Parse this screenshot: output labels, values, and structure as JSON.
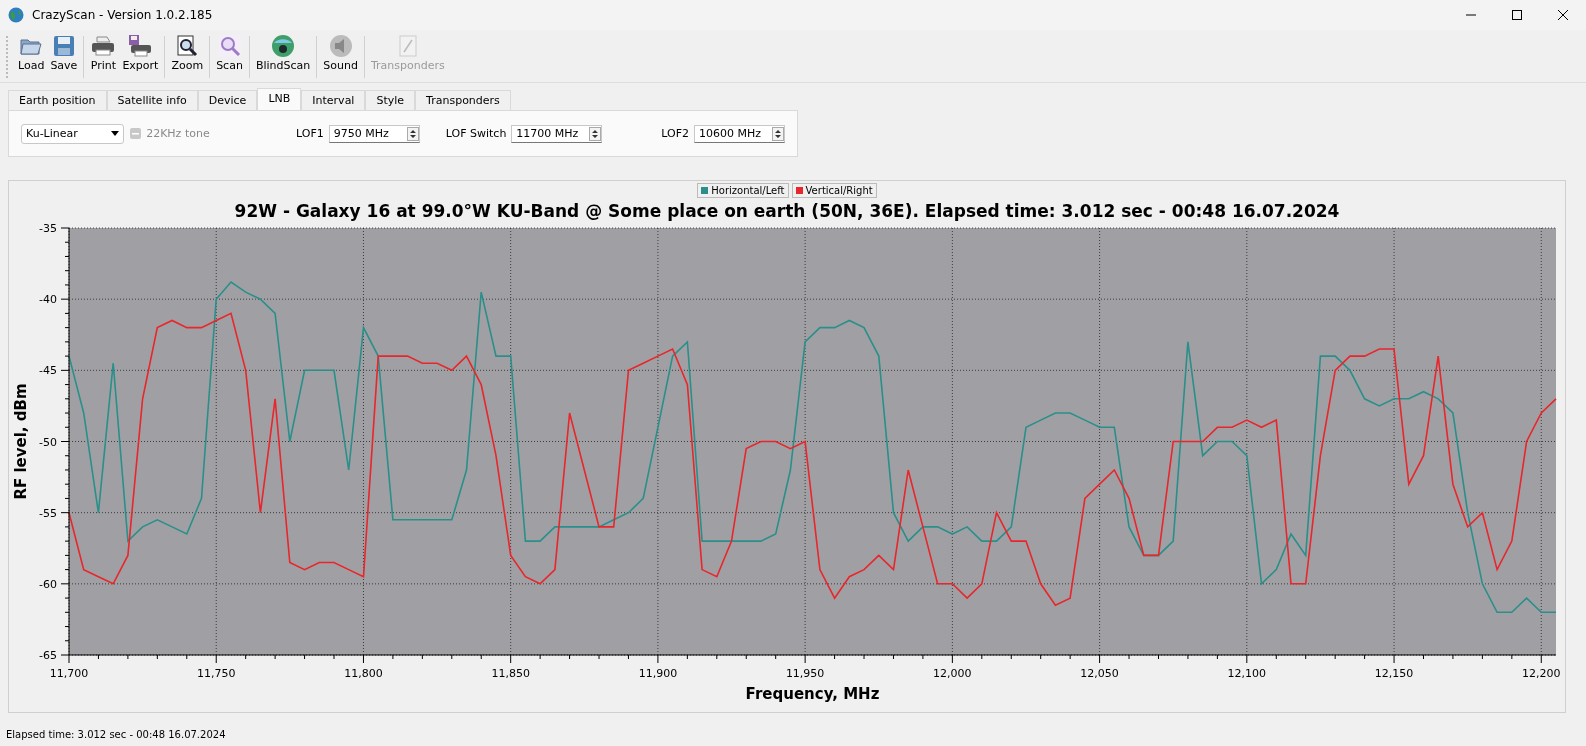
{
  "window": {
    "title": "CrazyScan - Version 1.0.2.185"
  },
  "toolbar": {
    "groups": [
      [
        {
          "label": "Load",
          "disabled": false
        },
        {
          "label": "Save",
          "disabled": false
        }
      ],
      [
        {
          "label": "Print",
          "disabled": false
        },
        {
          "label": "Export",
          "disabled": false
        }
      ],
      [
        {
          "label": "Zoom",
          "disabled": false
        }
      ],
      [
        {
          "label": "Scan",
          "disabled": false
        }
      ],
      [
        {
          "label": "BlindScan",
          "disabled": false
        }
      ],
      [
        {
          "label": "Sound",
          "disabled": false
        }
      ],
      [
        {
          "label": "Transponders",
          "disabled": true
        }
      ]
    ]
  },
  "tabs": [
    {
      "label": "Earth position",
      "selected": false
    },
    {
      "label": "Satellite info",
      "selected": false
    },
    {
      "label": "Device",
      "selected": false
    },
    {
      "label": "LNB",
      "selected": true
    },
    {
      "label": "Interval",
      "selected": false
    },
    {
      "label": "Style",
      "selected": false
    },
    {
      "label": "Transponders",
      "selected": false
    }
  ],
  "lnb": {
    "band_select": {
      "value": "Ku-Linear"
    },
    "tone": {
      "label": "22KHz tone",
      "checked": false,
      "disabled": true
    },
    "fields": [
      {
        "label": "LOF1",
        "value": "9750 MHz"
      },
      {
        "label": "LOF Switch",
        "value": "11700 MHz"
      },
      {
        "label": "LOF2",
        "value": "10600 MHz"
      }
    ]
  },
  "chart": {
    "chart_data": {
      "type": "line",
      "grid": true,
      "title": "92W - Galaxy 16 at 99.0°W KU-Band @ Some place on earth (50N, 36E). Elapsed time: 3.012 sec - 00:48 16.07.2024",
      "xlabel": "Frequency, MHz",
      "ylabel": "RF level, dBm",
      "x": [
        11700,
        11705,
        11710,
        11715,
        11720,
        11725,
        11730,
        11735,
        11740,
        11745,
        11750,
        11755,
        11760,
        11765,
        11770,
        11775,
        11780,
        11785,
        11790,
        11795,
        11800,
        11805,
        11810,
        11815,
        11820,
        11825,
        11830,
        11835,
        11840,
        11845,
        11850,
        11855,
        11860,
        11865,
        11870,
        11875,
        11880,
        11885,
        11890,
        11895,
        11900,
        11905,
        11910,
        11915,
        11920,
        11925,
        11930,
        11935,
        11940,
        11945,
        11950,
        11955,
        11960,
        11965,
        11970,
        11975,
        11980,
        11985,
        11990,
        11995,
        12000,
        12005,
        12010,
        12015,
        12020,
        12025,
        12030,
        12035,
        12040,
        12045,
        12050,
        12055,
        12060,
        12065,
        12070,
        12075,
        12080,
        12085,
        12090,
        12095,
        12100,
        12105,
        12110,
        12115,
        12120,
        12125,
        12130,
        12135,
        12140,
        12145,
        12150,
        12155,
        12160,
        12165,
        12170,
        12175,
        12180,
        12185,
        12190,
        12195,
        12200,
        12205
      ],
      "series": [
        {
          "name": "Horizontal/Left",
          "color": "#2a8f8a",
          "values": [
            -44,
            -48,
            -55,
            -44.5,
            -57,
            -56,
            -55.5,
            -56,
            -56.5,
            -54,
            -40,
            -38.8,
            -39.5,
            -40,
            -41,
            -50,
            -45,
            -45,
            -45,
            -52,
            -42,
            -44,
            -55.5,
            -55.5,
            -55.5,
            -55.5,
            -55.5,
            -52,
            -39.5,
            -44,
            -44,
            -57,
            -57,
            -56,
            -56,
            -56,
            -56,
            -55.5,
            -55,
            -54,
            -49,
            -44,
            -43,
            -57,
            -57,
            -57,
            -57,
            -57,
            -56.5,
            -52,
            -43,
            -42,
            -42,
            -41.5,
            -42,
            -44,
            -55,
            -57,
            -56,
            -56,
            -56.5,
            -56,
            -57,
            -57,
            -56,
            -49,
            -48.5,
            -48,
            -48,
            -48.5,
            -49,
            -49,
            -56,
            -58,
            -58,
            -57,
            -43,
            -51,
            -50,
            -50,
            -51,
            -60,
            -59,
            -56.5,
            -58,
            -44,
            -44,
            -45,
            -47,
            -47.5,
            -47,
            -47,
            -46.5,
            -47,
            -48,
            -55,
            -60,
            -62,
            -62,
            -61,
            -62,
            -62
          ]
        },
        {
          "name": "Vertical/Right",
          "color": "#e8262b",
          "values": [
            -55,
            -59,
            -59.5,
            -60,
            -58,
            -47,
            -42,
            -41.5,
            -42,
            -42,
            -41.5,
            -41,
            -45,
            -55,
            -47,
            -58.5,
            -59,
            -58.5,
            -58.5,
            -59,
            -59.5,
            -44,
            -44,
            -44,
            -44.5,
            -44.5,
            -45,
            -44,
            -46,
            -51,
            -58,
            -59.5,
            -60,
            -59,
            -48,
            -52,
            -56,
            -56,
            -45,
            -44.5,
            -44,
            -43.5,
            -46,
            -59,
            -59.5,
            -57,
            -50.5,
            -50,
            -50,
            -50.5,
            -50,
            -59,
            -61,
            -59.5,
            -59,
            -58,
            -59,
            -52,
            -56,
            -60,
            -60,
            -61,
            -60,
            -55,
            -57,
            -57,
            -60,
            -61.5,
            -61,
            -54,
            -53,
            -52,
            -54,
            -58,
            -58,
            -50,
            -50,
            -50,
            -49,
            -49,
            -48.5,
            -49,
            -48.5,
            -60,
            -60,
            -51,
            -45,
            -44,
            -44,
            -43.5,
            -43.5,
            -53,
            -51,
            -44,
            -53,
            -56,
            -55,
            -59,
            -57,
            -50,
            -48,
            -47
          ]
        }
      ],
      "xlim": [
        11700,
        12205
      ],
      "ylim": [
        -65,
        -35
      ],
      "xticks": [
        {
          "value": 11700,
          "label": "11,700"
        },
        {
          "value": 11750,
          "label": "11,750"
        },
        {
          "value": 11800,
          "label": "11,800"
        },
        {
          "value": 11850,
          "label": "11,850"
        },
        {
          "value": 11900,
          "label": "11,900"
        },
        {
          "value": 11950,
          "label": "11,950"
        },
        {
          "value": 12000,
          "label": "12,000"
        },
        {
          "value": 12050,
          "label": "12,050"
        },
        {
          "value": 12100,
          "label": "12,100"
        },
        {
          "value": 12150,
          "label": "12,150"
        },
        {
          "value": 12200,
          "label": "12,200"
        }
      ],
      "yticks": [
        -65,
        -60,
        -55,
        -50,
        -45,
        -40,
        -35
      ]
    }
  },
  "status_bar": {
    "text": "Elapsed time: 3.012 sec - 00:48 16.07.2024"
  }
}
